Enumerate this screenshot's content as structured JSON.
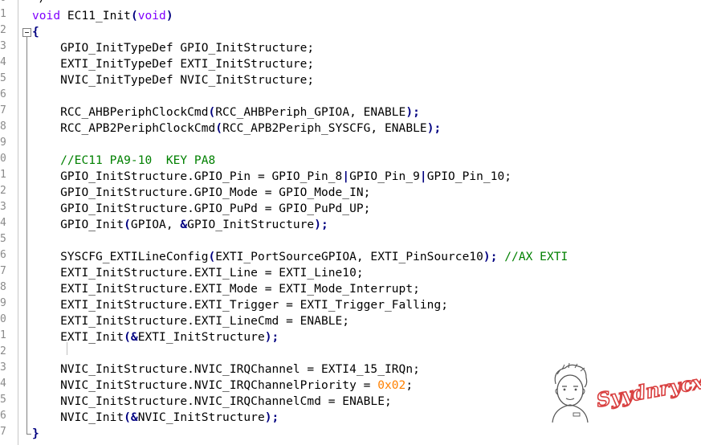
{
  "editor": {
    "line_numbers": [
      "0",
      "1",
      "2",
      "3",
      "4",
      "5",
      "6",
      "7",
      "8",
      "9",
      "0",
      "1",
      "2",
      "3",
      "4",
      "5",
      "6",
      "7",
      "8",
      "9",
      "0",
      "1",
      "2",
      "3",
      "4",
      "5",
      "6",
      "7"
    ],
    "top_partial": "*/",
    "lines": [
      [
        {
          "t": "void ",
          "c": "kw"
        },
        {
          "t": "EC11_Init",
          "c": "plain"
        },
        {
          "t": "(",
          "c": "op"
        },
        {
          "t": "void",
          "c": "kw"
        },
        {
          "t": ")",
          "c": "op"
        }
      ],
      [
        {
          "t": "{",
          "c": "op"
        }
      ],
      [
        {
          "t": "    GPIO_InitTypeDef GPIO_InitStructure;",
          "c": "plain"
        }
      ],
      [
        {
          "t": "    EXTI_InitTypeDef EXTI_InitStructure;",
          "c": "plain"
        }
      ],
      [
        {
          "t": "    NVIC_InitTypeDef NVIC_InitStructure;",
          "c": "plain"
        }
      ],
      [],
      [
        {
          "t": "    RCC_AHBPeriphClockCmd",
          "c": "plain"
        },
        {
          "t": "(",
          "c": "op"
        },
        {
          "t": "RCC_AHBPeriph_GPIOA, ENABLE",
          "c": "plain"
        },
        {
          "t": ");",
          "c": "op"
        }
      ],
      [
        {
          "t": "    RCC_APB2PeriphClockCmd",
          "c": "plain"
        },
        {
          "t": "(",
          "c": "op"
        },
        {
          "t": "RCC_APB2Periph_SYSCFG, ENABLE",
          "c": "plain"
        },
        {
          "t": ");",
          "c": "op"
        }
      ],
      [],
      [
        {
          "t": "    //EC11 PA9-10  KEY PA8",
          "c": "cm"
        }
      ],
      [
        {
          "t": "    GPIO_InitStructure.GPIO_Pin = GPIO_Pin_8",
          "c": "plain"
        },
        {
          "t": "|",
          "c": "op"
        },
        {
          "t": "GPIO_Pin_9",
          "c": "plain"
        },
        {
          "t": "|",
          "c": "op"
        },
        {
          "t": "GPIO_Pin_10;",
          "c": "plain"
        }
      ],
      [
        {
          "t": "    GPIO_InitStructure.GPIO_Mode = GPIO_Mode_IN;",
          "c": "plain"
        }
      ],
      [
        {
          "t": "    GPIO_InitStructure.GPIO_PuPd = GPIO_PuPd_UP;",
          "c": "plain"
        }
      ],
      [
        {
          "t": "    GPIO_Init",
          "c": "plain"
        },
        {
          "t": "(",
          "c": "op"
        },
        {
          "t": "GPIOA, ",
          "c": "plain"
        },
        {
          "t": "&",
          "c": "op"
        },
        {
          "t": "GPIO_InitStructure",
          "c": "plain"
        },
        {
          "t": ");",
          "c": "op"
        }
      ],
      [],
      [
        {
          "t": "    SYSCFG_EXTILineConfig",
          "c": "plain"
        },
        {
          "t": "(",
          "c": "op"
        },
        {
          "t": "EXTI_PortSourceGPIOA, EXTI_PinSource10",
          "c": "plain"
        },
        {
          "t": ");",
          "c": "op"
        },
        {
          "t": " //AX EXTI",
          "c": "cm"
        }
      ],
      [
        {
          "t": "    EXTI_InitStructure.EXTI_Line = EXTI_Line10;",
          "c": "plain"
        }
      ],
      [
        {
          "t": "    EXTI_InitStructure.EXTI_Mode = EXTI_Mode_Interrupt;",
          "c": "plain"
        }
      ],
      [
        {
          "t": "    EXTI_InitStructure.EXTI_Trigger = EXTI_Trigger_Falling;",
          "c": "plain"
        }
      ],
      [
        {
          "t": "    EXTI_InitStructure.EXTI_LineCmd = ENABLE;",
          "c": "plain"
        }
      ],
      [
        {
          "t": "    EXTI_Init",
          "c": "plain"
        },
        {
          "t": "(&",
          "c": "op"
        },
        {
          "t": "EXTI_InitStructure",
          "c": "plain"
        },
        {
          "t": ");",
          "c": "op"
        }
      ],
      [],
      [
        {
          "t": "    NVIC_InitStructure.NVIC_IRQChannel = EXTI4_15_IRQn;",
          "c": "plain"
        }
      ],
      [
        {
          "t": "    NVIC_InitStructure.NVIC_IRQChannelPriority = ",
          "c": "plain"
        },
        {
          "t": "0x02",
          "c": "num"
        },
        {
          "t": ";",
          "c": "plain"
        }
      ],
      [
        {
          "t": "    NVIC_InitStructure.NVIC_IRQChannelCmd = ENABLE;",
          "c": "plain"
        }
      ],
      [
        {
          "t": "    NVIC_Init",
          "c": "plain"
        },
        {
          "t": "(&",
          "c": "op"
        },
        {
          "t": "NVIC_InitStructure",
          "c": "plain"
        },
        {
          "t": ");",
          "c": "op"
        }
      ],
      [
        {
          "t": "}",
          "c": "op"
        }
      ]
    ]
  },
  "watermark": {
    "signature": "Syydnrycx",
    "avatar_icon": "hand-drawn-avatar-icon"
  },
  "colors": {
    "keyword": "#8000ff",
    "operator": "#000080",
    "comment": "#008000",
    "number": "#ff8000"
  }
}
